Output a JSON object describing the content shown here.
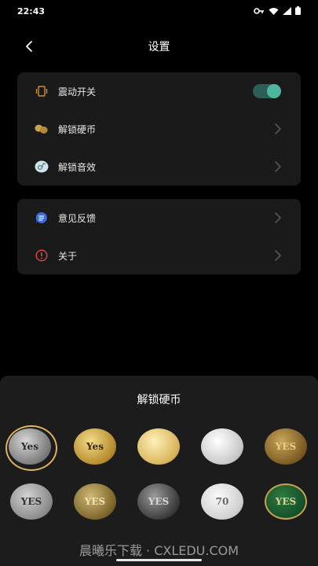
{
  "status_bar": {
    "time": "22:43",
    "icons": [
      "key-icon",
      "wifi-icon",
      "signal-icon",
      "battery-icon"
    ]
  },
  "header": {
    "title": "设置",
    "back_icon": "back-arrow-icon"
  },
  "settings": {
    "group1": [
      {
        "label": "震动开关",
        "icon": "vibration-icon",
        "control": "toggle",
        "toggle_on": true
      },
      {
        "label": "解锁硬币",
        "icon": "coins-icon",
        "control": "chevron"
      },
      {
        "label": "解锁音效",
        "icon": "sound-effect-icon",
        "control": "chevron"
      }
    ],
    "group2": [
      {
        "label": "意见反馈",
        "icon": "feedback-icon",
        "control": "chevron"
      },
      {
        "label": "关于",
        "icon": "info-icon",
        "control": "chevron"
      }
    ]
  },
  "coin_sheet": {
    "title": "解锁硬币",
    "selected_index": 0,
    "coins": [
      {
        "face": "Yes",
        "style": "silver-dark"
      },
      {
        "face": "Yes",
        "style": "gold-ornate"
      },
      {
        "face": "",
        "style": "gold-pale"
      },
      {
        "face": "",
        "style": "silver-bright"
      },
      {
        "face": "YES",
        "style": "bronze"
      },
      {
        "face": "YES",
        "style": "silver-antique"
      },
      {
        "face": "YES",
        "style": "gold-antique"
      },
      {
        "face": "YES",
        "style": "black-silver"
      },
      {
        "face": "70",
        "style": "silver-plain"
      },
      {
        "face": "YES",
        "style": "green-enamel"
      }
    ]
  },
  "watermark": "晨曦乐下载 · CXLEDU.COM",
  "colors": {
    "background": "#000000",
    "card": "#1a1a1a",
    "sheet": "#1c1c1c",
    "toggle_accent": "#4cb69e",
    "selected_ring": "#e0b25e"
  }
}
